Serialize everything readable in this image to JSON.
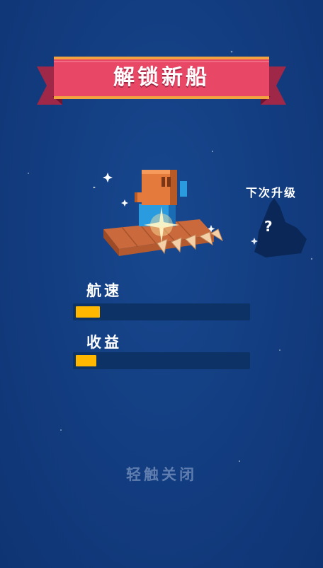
{
  "banner": {
    "title": "解锁新船"
  },
  "preview": {
    "next_upgrade_label": "下次升级",
    "unknown_symbol": "?"
  },
  "stats": [
    {
      "label": "航速",
      "level": 0.14
    },
    {
      "label": "收益",
      "level": 0.12
    }
  ],
  "footer": {
    "close_label": "轻触关闭"
  },
  "colors": {
    "background": "#133e82",
    "banner_red": "#e94766",
    "banner_gold": "#f2a340",
    "bar_fill": "#ffb700",
    "bar_track": "#0c3266"
  },
  "icons": {
    "ship": "wooden-raft-ship-icon",
    "next_ship": "mystery-silhouette-icon"
  }
}
